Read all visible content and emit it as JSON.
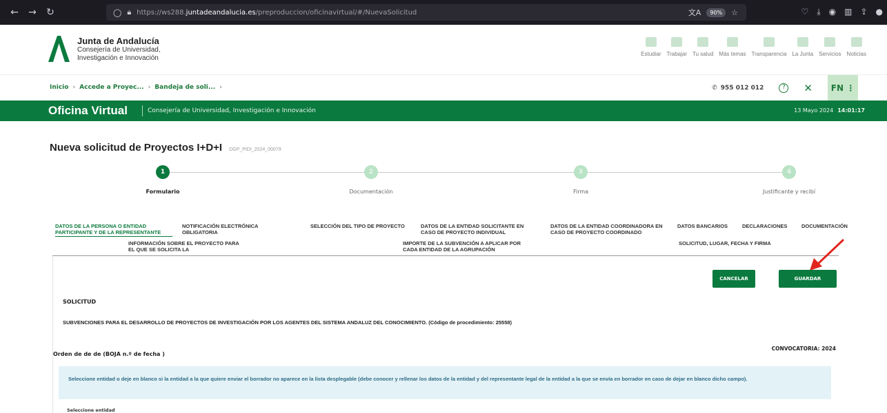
{
  "browser": {
    "url_prefix": "https://ws288.",
    "url_host": "juntadeandalucia.es",
    "url_path": "/preproduccion/oficinavirtual/#/NuevaSolicitud",
    "zoom": "90%"
  },
  "header": {
    "brand_name": "Junta de Andalucía",
    "brand_sub_1": "Consejería de Universidad,",
    "brand_sub_2": "Investigación e Innovación",
    "nav": [
      "Estudiar",
      "Trabajar",
      "Tu salud",
      "Más temas",
      "Transparencia",
      "La Junta",
      "Servicios",
      "Noticias"
    ]
  },
  "breadcrumb": {
    "items": [
      "Inicio",
      "Accede a Proyec...",
      "Bandeja de soli..."
    ],
    "phone": "955 012 012",
    "user_initials": "FN"
  },
  "band": {
    "title": "Oficina Virtual",
    "subtitle": "Consejería de Universidad, Investigación e Innovación",
    "date": "13 Mayo 2024",
    "time": "14:01:17"
  },
  "page": {
    "title": "Nueva solicitud de Proyectos I+D+I",
    "code": "DGP_PIDI_2024_00079"
  },
  "steps": [
    {
      "num": "1",
      "label": "Formulario"
    },
    {
      "num": "2",
      "label": "Documentación"
    },
    {
      "num": "3",
      "label": "Firma"
    },
    {
      "num": "4",
      "label": "Justificante y recibí"
    }
  ],
  "tabs": {
    "t1": "DATOS DE LA PERSONA O ENTIDAD PARTICIPANTE Y DE LA REPRESENTANTE",
    "t2": "NOTIFICACIÓN ELECTRÓNICA OBLIGATORIA",
    "t3": "SELECCIÓN DEL TIPO DE PROYECTO",
    "t4": "DATOS DE LA ENTIDAD SOLICITANTE EN CASO DE PROYECTO INDIVIDUAL",
    "t5": "DATOS DE LA ENTIDAD COORDINADORA EN CASO DE PROYECTO COORDINADO",
    "t6": "DATOS BANCARIOS",
    "t7": "DECLARACIONES",
    "t8": "DOCUMENTACIÓN",
    "t9": "INFORMACIÓN SOBRE EL PROYECTO PARA EL QUE SE SOLICITA LA",
    "t10": "IMPORTE DE LA SUBVENCIÓN A APLICAR POR CADA ENTIDAD DE LA AGRUPACIÓN",
    "t11": "SOLICITUD, LUGAR, FECHA Y FIRMA"
  },
  "form": {
    "cancel_label": "CANCELAR",
    "save_label": "GUARDAR",
    "section": "SOLICITUD",
    "subvenciones": "SUBVENCIONES PARA EL DESARROLLO DE PROYECTOS DE INVESTIGACIÓN POR LOS AGENTES DEL SISTEMA ANDALUZ DEL CONOCIMIENTO. (Código de procedimiento: 25558)",
    "convocatoria": "CONVOCATORIA: 2024",
    "orden": "Orden de de de (BOJA n.º de fecha )",
    "info": "Seleccione entidad o deje en blanco si la entidad a la que quiere enviar el borrador no aparece en la lista desplegable (debe conocer y rellenar los datos de la entidad y del representante legal de la entidad a la que se envía en borrador en caso de dejar en blanco dicho campo).",
    "select_label": "Seleccione entidad"
  }
}
